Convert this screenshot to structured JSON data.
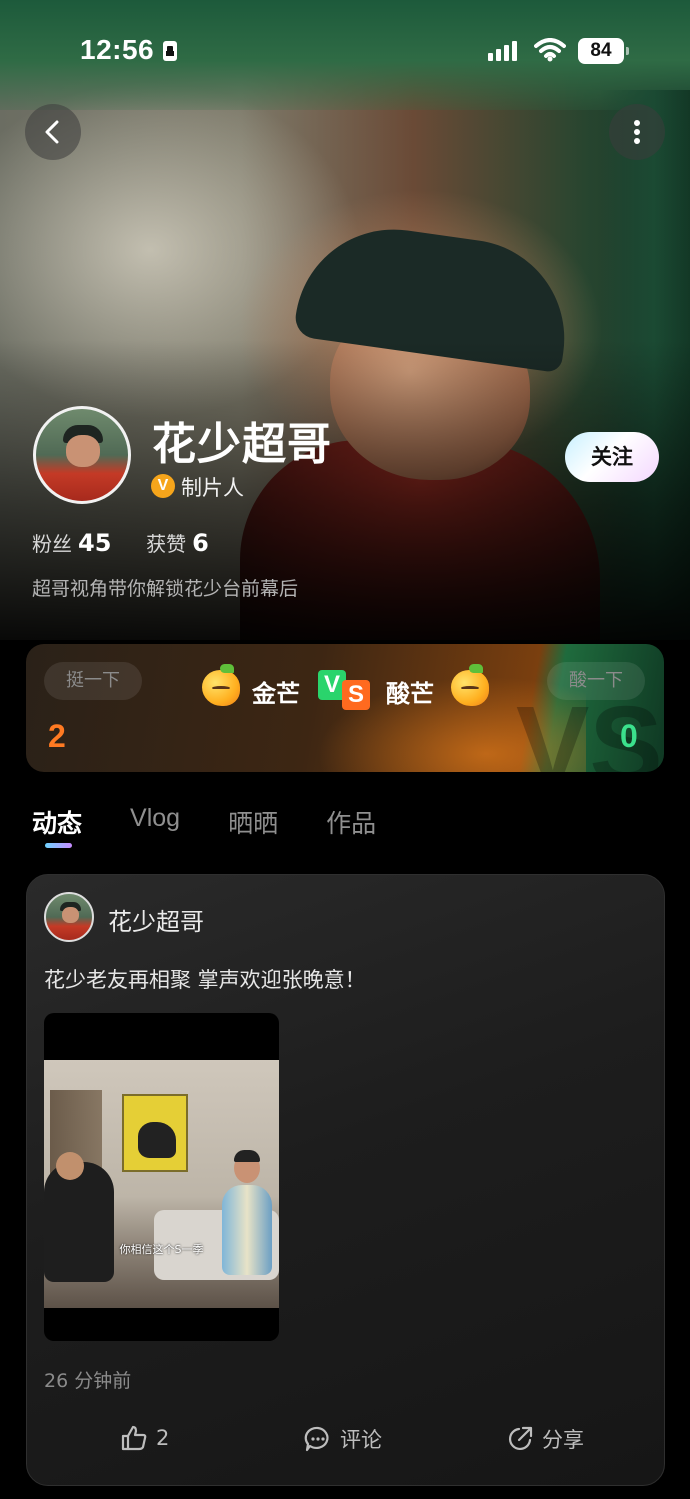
{
  "status_bar": {
    "time": "12:56",
    "battery": "84"
  },
  "profile": {
    "name": "花少超哥",
    "role_badge": "V",
    "role": "制片人",
    "follow_label": "关注",
    "fans_label": "粉丝",
    "fans_count": "45",
    "likes_label": "获赞",
    "likes_count": "6",
    "bio": "超哥视角带你解锁花少台前幕后"
  },
  "vs_card": {
    "left_button": "挺一下",
    "right_button": "酸一下",
    "left_label": "金芒",
    "right_label": "酸芒",
    "v_letter": "V",
    "s_letter": "S",
    "left_score": "2",
    "right_score": "0",
    "colors": {
      "left": "#ff7a22",
      "right": "#3be08c"
    }
  },
  "tabs": [
    {
      "label": "动态",
      "active": true
    },
    {
      "label": "Vlog",
      "active": false
    },
    {
      "label": "晒晒",
      "active": false
    },
    {
      "label": "作品",
      "active": false
    }
  ],
  "post": {
    "author": "花少超哥",
    "text": "花少老友再相聚 掌声欢迎张晚意！",
    "video_subtitle": "你相信这个S一季",
    "time": "26 分钟前",
    "like_count": "2",
    "comment_label": "评论",
    "share_label": "分享"
  },
  "icons": {
    "back": "chevron-left-icon",
    "more": "more-vertical-icon",
    "like": "thumbs-up-icon",
    "comment": "comment-icon",
    "share": "share-icon"
  }
}
